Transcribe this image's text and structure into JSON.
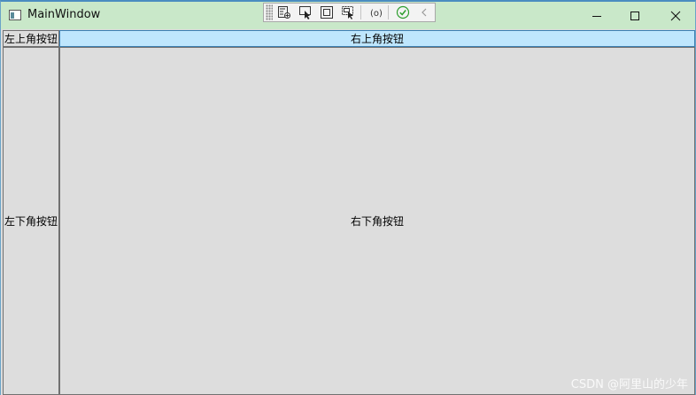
{
  "window": {
    "title": "MainWindow"
  },
  "buttons": {
    "top_left": "左上角按钮",
    "top_right": "右上角按钮",
    "bottom_left": "左下角按钮",
    "bottom_right": "右下角按钮"
  },
  "watermark": "CSDN @阿里山的少年",
  "colors": {
    "titlebar_bg": "#c9e8c9",
    "button_bg": "#dddddd",
    "button_hover_bg": "#bee6fd",
    "button_border": "#707070"
  },
  "icons": {
    "app": "app-window-icon",
    "minimize": "minimize-icon",
    "maximize": "maximize-icon",
    "close": "close-icon",
    "debug_toolbar": [
      "live-visual-tree-icon",
      "select-element-icon",
      "display-layout-adorners-icon",
      "track-focused-element-icon",
      "binding-failures-icon",
      "hot-reload-ok-icon",
      "collapse-toolbar-icon"
    ]
  }
}
